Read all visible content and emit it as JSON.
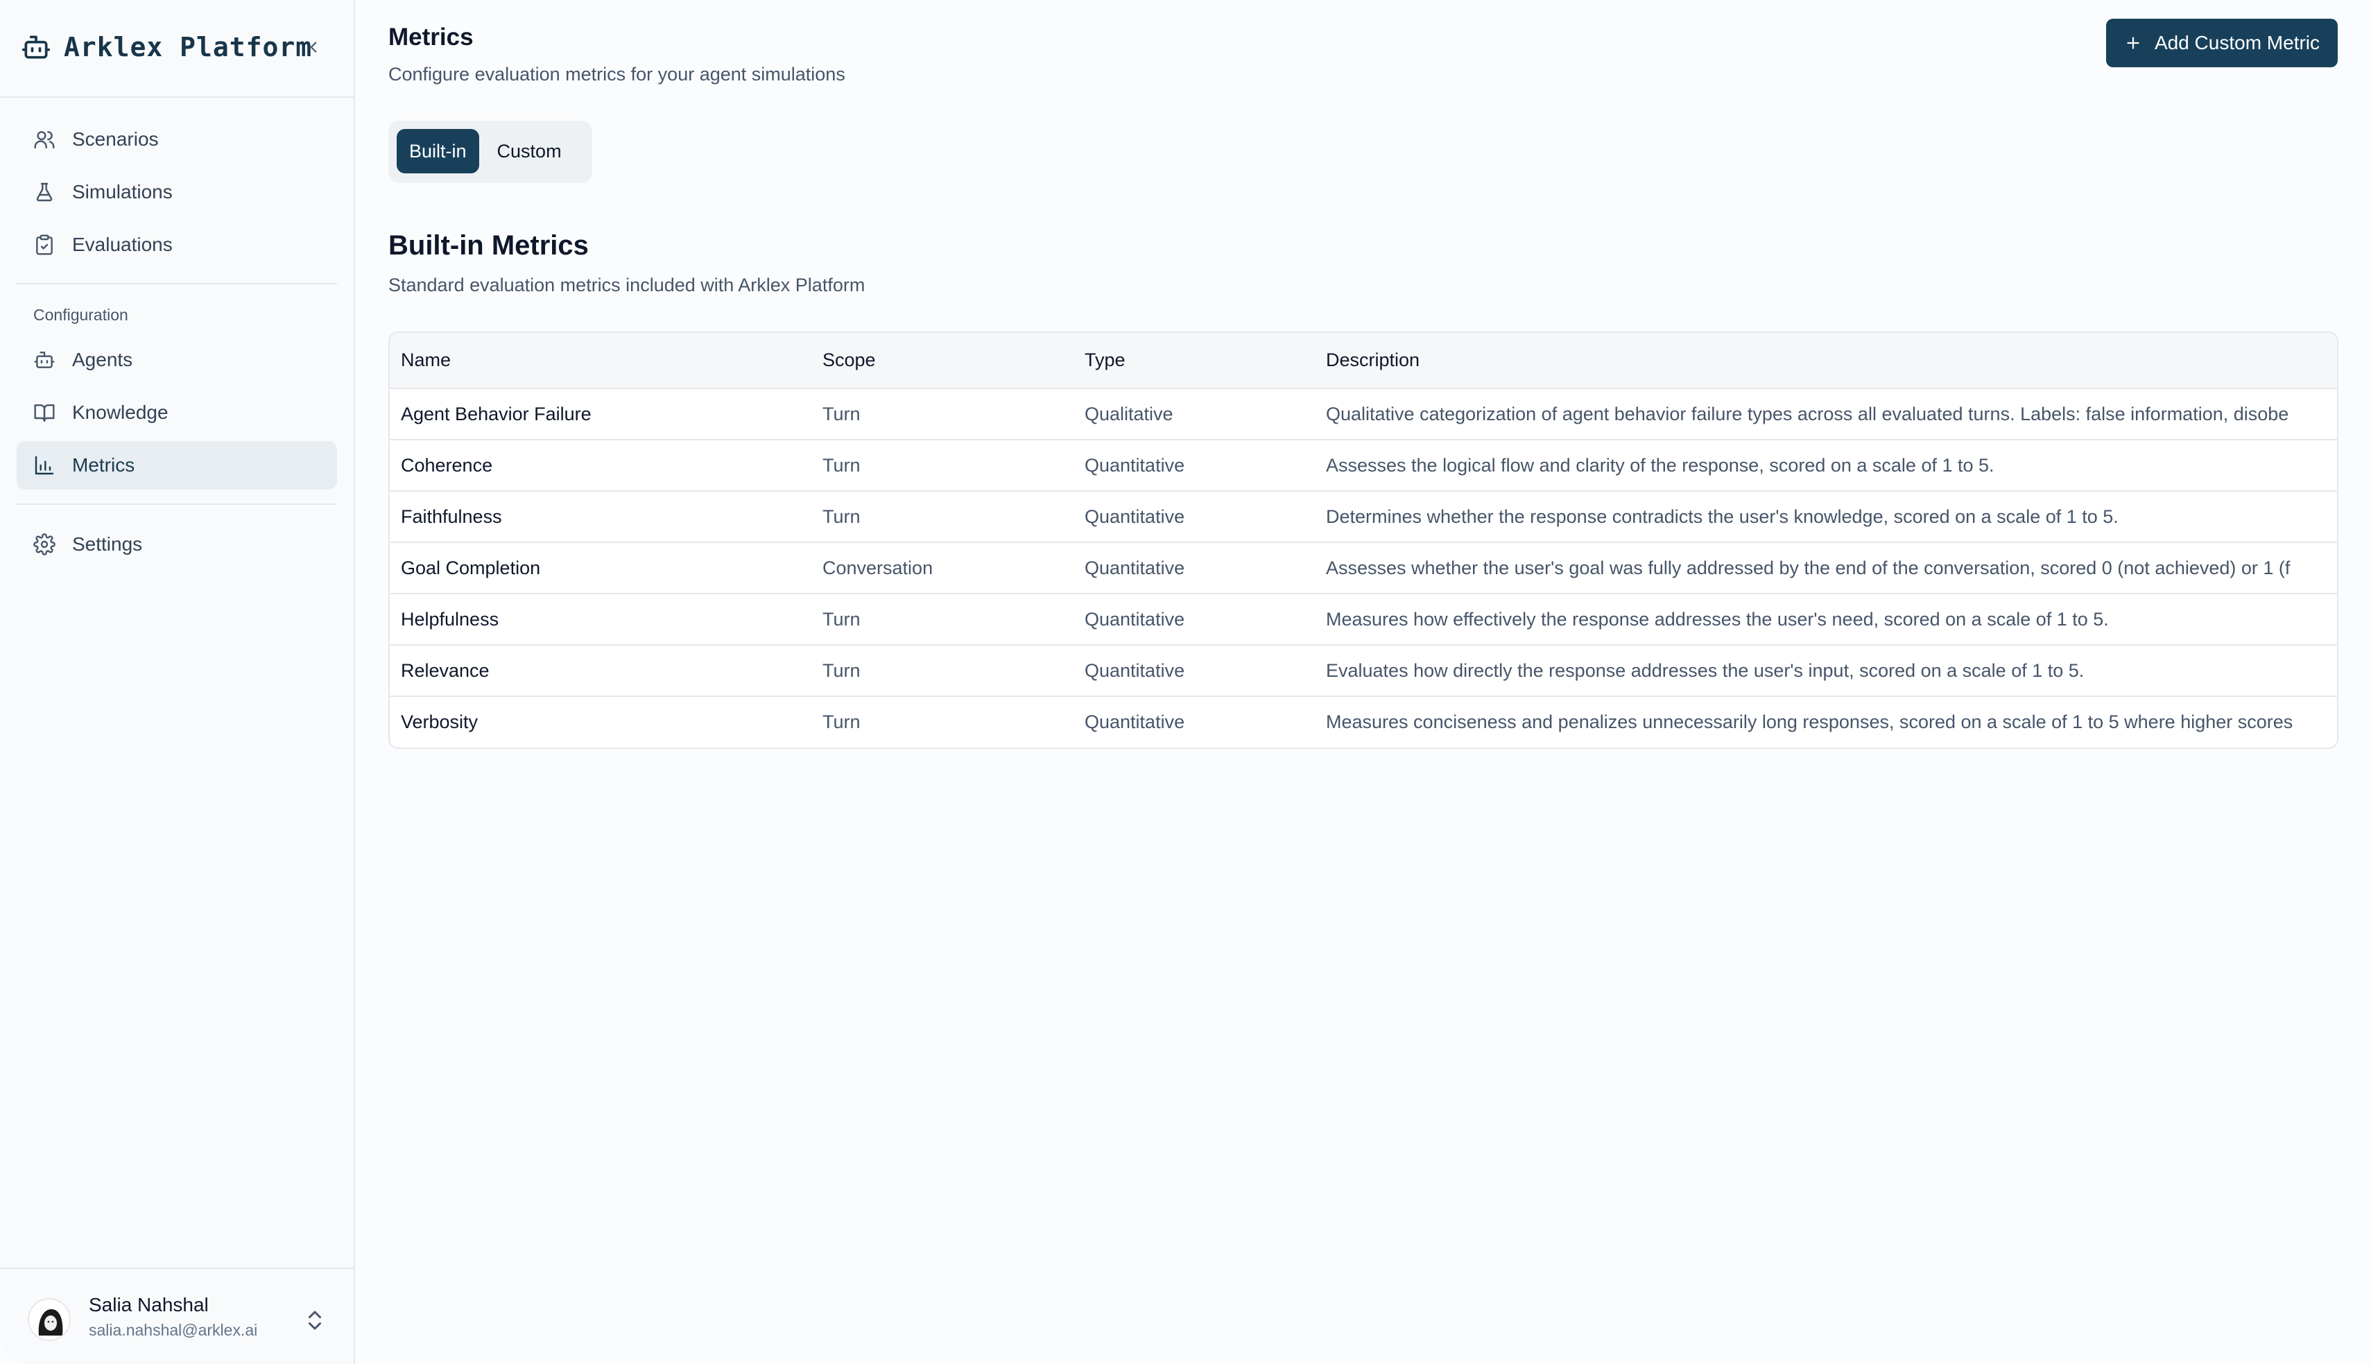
{
  "app": {
    "brand_name": "Arklex Platform"
  },
  "sidebar": {
    "nav_main": [
      {
        "label": "Scenarios",
        "icon": "users-icon"
      },
      {
        "label": "Simulations",
        "icon": "flask-icon"
      },
      {
        "label": "Evaluations",
        "icon": "clipboard-check-icon"
      }
    ],
    "config_label": "Configuration",
    "nav_config": [
      {
        "label": "Agents",
        "icon": "bot-icon"
      },
      {
        "label": "Knowledge",
        "icon": "book-open-icon"
      },
      {
        "label": "Metrics",
        "icon": "bar-chart-icon",
        "active": true
      }
    ],
    "settings": {
      "label": "Settings",
      "icon": "gear-icon"
    }
  },
  "user": {
    "name": "Salia Nahshal",
    "email": "salia.nahshal@arklex.ai"
  },
  "header": {
    "title": "Metrics",
    "subtitle": "Configure evaluation metrics for your agent simulations",
    "add_button_label": "Add Custom Metric"
  },
  "tabs": [
    {
      "label": "Built-in",
      "active": true
    },
    {
      "label": "Custom",
      "active": false
    }
  ],
  "section": {
    "title": "Built-in Metrics",
    "subtitle": "Standard evaluation metrics included with Arklex Platform"
  },
  "table": {
    "columns": [
      "Name",
      "Scope",
      "Type",
      "Description"
    ],
    "rows": [
      {
        "name": "Agent Behavior Failure",
        "scope": "Turn",
        "type": "Qualitative",
        "description": "Qualitative categorization of agent behavior failure types across all evaluated turns. Labels: false information, disobe"
      },
      {
        "name": "Coherence",
        "scope": "Turn",
        "type": "Quantitative",
        "description": "Assesses the logical flow and clarity of the response, scored on a scale of 1 to 5."
      },
      {
        "name": "Faithfulness",
        "scope": "Turn",
        "type": "Quantitative",
        "description": "Determines whether the response contradicts the user's knowledge, scored on a scale of 1 to 5."
      },
      {
        "name": "Goal Completion",
        "scope": "Conversation",
        "type": "Quantitative",
        "description": "Assesses whether the user's goal was fully addressed by the end of the conversation, scored 0 (not achieved) or 1 (f"
      },
      {
        "name": "Helpfulness",
        "scope": "Turn",
        "type": "Quantitative",
        "description": "Measures how effectively the response addresses the user's need, scored on a scale of 1 to 5."
      },
      {
        "name": "Relevance",
        "scope": "Turn",
        "type": "Quantitative",
        "description": "Evaluates how directly the response addresses the user's input, scored on a scale of 1 to 5."
      },
      {
        "name": "Verbosity",
        "scope": "Turn",
        "type": "Quantitative",
        "description": "Measures conciseness and penalizes unnecessarily long responses, scored on a scale of 1 to 5 where higher scores"
      }
    ]
  },
  "colors": {
    "accent": "#18405a",
    "active_nav_bg": "#e8edf1",
    "border": "#e5e7eb"
  }
}
